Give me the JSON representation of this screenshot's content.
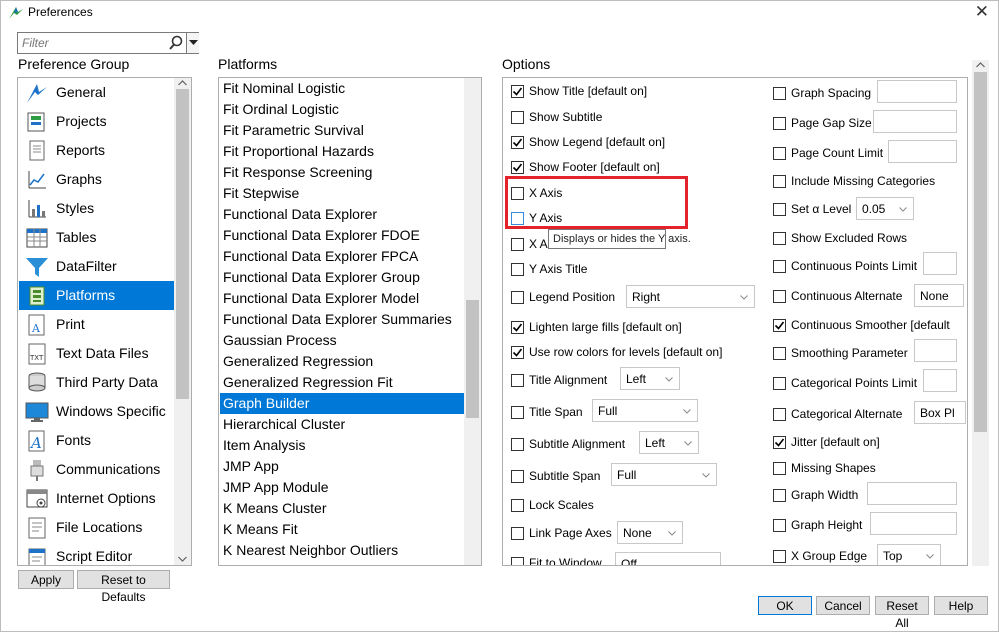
{
  "window": {
    "title": "Preferences"
  },
  "filter": {
    "placeholder": "Filter"
  },
  "sections": {
    "preference_group": "Preference Group",
    "platforms": "Platforms",
    "options": "Options"
  },
  "preference_groups": [
    {
      "label": "General",
      "icon": "general-icon"
    },
    {
      "label": "Projects",
      "icon": "projects-icon"
    },
    {
      "label": "Reports",
      "icon": "reports-icon"
    },
    {
      "label": "Graphs",
      "icon": "graphs-icon"
    },
    {
      "label": "Styles",
      "icon": "styles-icon"
    },
    {
      "label": "Tables",
      "icon": "tables-icon"
    },
    {
      "label": "DataFilter",
      "icon": "funnel-icon"
    },
    {
      "label": "Platforms",
      "icon": "platforms-icon",
      "selected": true
    },
    {
      "label": "Print",
      "icon": "print-icon"
    },
    {
      "label": "Text Data Files",
      "icon": "text-data-icon"
    },
    {
      "label": "Third Party Data",
      "icon": "third-party-data-icon"
    },
    {
      "label": "Windows Specific",
      "icon": "monitor-icon"
    },
    {
      "label": "Fonts",
      "icon": "fonts-icon"
    },
    {
      "label": "Communications",
      "icon": "communications-icon"
    },
    {
      "label": "Internet Options",
      "icon": "internet-options-icon"
    },
    {
      "label": "File Locations",
      "icon": "folder-icon"
    },
    {
      "label": "Script Editor",
      "icon": "script-editor-icon"
    }
  ],
  "platforms": [
    "Fit Nominal Logistic",
    "Fit Ordinal Logistic",
    "Fit Parametric Survival",
    "Fit Proportional Hazards",
    "Fit Response Screening",
    "Fit Stepwise",
    "Functional Data Explorer",
    "Functional Data Explorer FDOE",
    "Functional Data Explorer FPCA",
    "Functional Data Explorer Group",
    "Functional Data Explorer Model",
    "Functional Data Explorer Summaries",
    "Gaussian Process",
    "Generalized Regression",
    "Generalized Regression Fit",
    "Graph Builder",
    "Hierarchical Cluster",
    "Item Analysis",
    "JMP App",
    "JMP App Module",
    "K Means Cluster",
    "K Means Fit",
    "K Nearest Neighbor Outliers"
  ],
  "selected_platform": "Graph Builder",
  "options_left": [
    {
      "label": "Show Title [default on]",
      "checked": true
    },
    {
      "label": "Show Subtitle",
      "checked": false
    },
    {
      "label": "Show Legend [default on]",
      "checked": true
    },
    {
      "label": "Show Footer [default on]",
      "checked": true
    },
    {
      "label": "X Axis",
      "checked": false
    },
    {
      "label": "Y Axis",
      "checked": false
    },
    {
      "label": "X A",
      "checked": false
    },
    {
      "label": "Y Axis Title",
      "checked": false
    },
    {
      "label": "Legend Position",
      "checked": false,
      "value": "Right"
    },
    {
      "label": "Lighten large fills [default on]",
      "checked": true
    },
    {
      "label": "Use row colors for levels [default on]",
      "checked": true
    },
    {
      "label": "Title Alignment",
      "checked": false,
      "value": "Left"
    },
    {
      "label": "Title Span",
      "checked": false,
      "value": "Full"
    },
    {
      "label": "Subtitle Alignment",
      "checked": false,
      "value": "Left"
    },
    {
      "label": "Subtitle Span",
      "checked": false,
      "value": "Full"
    },
    {
      "label": "Lock Scales",
      "checked": false
    },
    {
      "label": "Link Page Axes",
      "checked": false,
      "value": "None"
    },
    {
      "label": "Fit to Window",
      "checked": false,
      "value": "Off"
    }
  ],
  "options_right": [
    {
      "label": "Graph Spacing",
      "checked": false
    },
    {
      "label": "Page Gap Size",
      "checked": false
    },
    {
      "label": "Page Count Limit",
      "checked": false
    },
    {
      "label": "Include Missing Categories",
      "checked": false
    },
    {
      "label": "Set α Level",
      "checked": false,
      "value": "0.05"
    },
    {
      "label": "Show Excluded Rows",
      "checked": false
    },
    {
      "label": "Continuous Points Limit",
      "checked": false
    },
    {
      "label": "Continuous Alternate",
      "checked": false,
      "value": "None"
    },
    {
      "label": "Continuous Smoother [default",
      "checked": true
    },
    {
      "label": "Smoothing Parameter",
      "checked": false
    },
    {
      "label": "Categorical Points Limit",
      "checked": false
    },
    {
      "label": "Categorical Alternate",
      "checked": false,
      "value": "Box Pl"
    },
    {
      "label": "Jitter [default on]",
      "checked": true
    },
    {
      "label": "Missing Shapes",
      "checked": false
    },
    {
      "label": "Graph Width",
      "checked": false
    },
    {
      "label": "Graph Height",
      "checked": false
    },
    {
      "label": "X Group Edge",
      "checked": false,
      "value": "Top"
    }
  ],
  "tooltip": "Displays or hides the Y axis.",
  "buttons": {
    "apply": "Apply",
    "reset_defaults": "Reset to Defaults",
    "ok": "OK",
    "cancel": "Cancel",
    "reset_all": "Reset All",
    "help": "Help"
  },
  "colors": {
    "selection": "#0078d7",
    "highlight": "#e4222b"
  }
}
